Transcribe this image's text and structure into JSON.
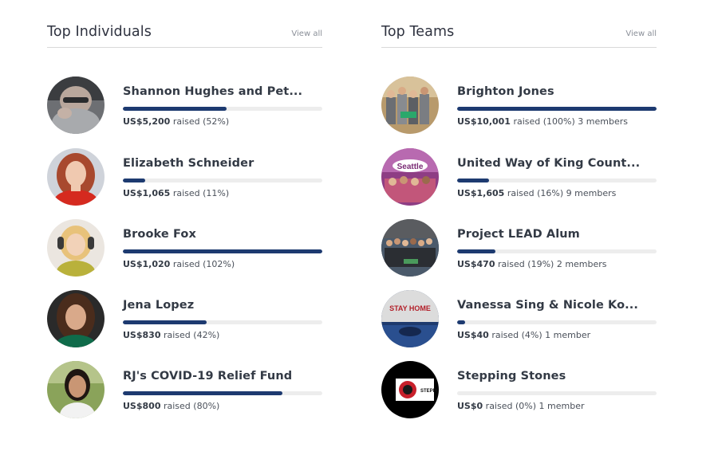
{
  "individuals": {
    "title": "Top Individuals",
    "view_all": "View all",
    "items": [
      {
        "name": "Shannon Hughes and Pet...",
        "amount": "US$5,200",
        "raised_text": "raised (52%)",
        "members": "",
        "progress": 0.52,
        "avatar": "photo-person-hands-on-face"
      },
      {
        "name": "Elizabeth Schneider",
        "amount": "US$1,065",
        "raised_text": "raised (11%)",
        "members": "",
        "progress": 0.11,
        "avatar": "photo-red-haired-woman"
      },
      {
        "name": "Brooke Fox",
        "amount": "US$1,020",
        "raised_text": "raised (102%)",
        "members": "",
        "progress": 1.0,
        "avatar": "photo-blonde-woman-headphones"
      },
      {
        "name": "Jena Lopez",
        "amount": "US$830",
        "raised_text": "raised (42%)",
        "members": "",
        "progress": 0.42,
        "avatar": "photo-brunette-woman"
      },
      {
        "name": "RJ's COVID-19 Relief Fund",
        "amount": "US$800",
        "raised_text": "raised (80%)",
        "members": "",
        "progress": 0.8,
        "avatar": "photo-woman-outdoors"
      }
    ]
  },
  "teams": {
    "title": "Top Teams",
    "view_all": "View all",
    "items": [
      {
        "name": "Brighton Jones",
        "amount": "US$10,001",
        "raised_text": "raised (100%)",
        "members": "3 members",
        "progress": 1.0,
        "avatar": "photo-group-in-office"
      },
      {
        "name": "United Way of King Count...",
        "amount": "US$1,605",
        "raised_text": "raised (16%)",
        "members": "9 members",
        "progress": 0.16,
        "avatar": "photo-seattle-group",
        "avatar_text": "Seattle"
      },
      {
        "name": "Project LEAD Alum",
        "amount": "US$470",
        "raised_text": "raised (19%)",
        "members": "2 members",
        "progress": 0.19,
        "avatar": "photo-large-group"
      },
      {
        "name": "Vanessa Sing & Nicole Ko...",
        "amount": "US$40",
        "raised_text": "raised (4%)",
        "members": "1 member",
        "progress": 0.04,
        "avatar": "photo-stay-home-sign",
        "avatar_text": "STAY HOME"
      },
      {
        "name": "Stepping Stones",
        "amount": "US$0",
        "raised_text": "raised (0%)",
        "members": "1 member",
        "progress": 0.0,
        "avatar": "logo-stepping-stones",
        "avatar_text": "STEPPI"
      }
    ]
  },
  "colors": {
    "progress_fill": "#1d3a70",
    "progress_track": "#ededed",
    "divider": "#d9d9d9"
  }
}
